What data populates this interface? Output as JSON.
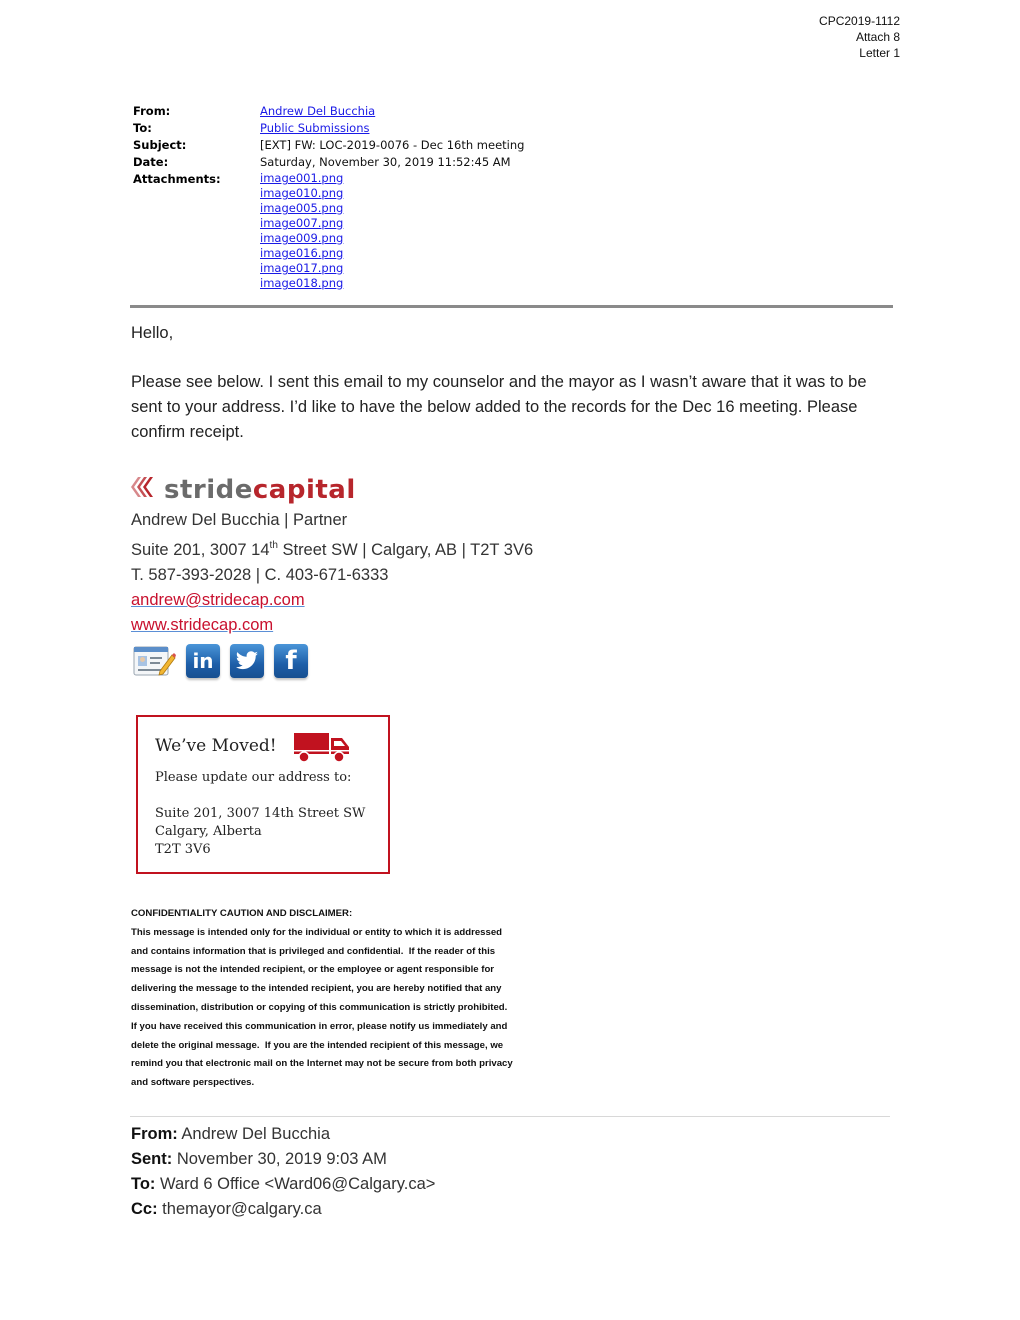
{
  "page_ref": {
    "lines": [
      "CPC2019-1112",
      "Attach 8",
      "Letter 1"
    ]
  },
  "email_header": {
    "from_label": "From:",
    "from_value": "Andrew Del Bucchia",
    "to_label": "To:",
    "to_value": "Public Submissions",
    "subject_label": "Subject:",
    "subject_value": "[EXT] FW: LOC-2019-0076 - Dec 16th meeting",
    "date_label": "Date:",
    "date_value": "Saturday, November 30, 2019 11:52:45 AM",
    "attachments_label": "Attachments:",
    "attachments": [
      "image001.png",
      "image010.png",
      "image005.png",
      "image007.png",
      "image009.png",
      "image016.png",
      "image017.png",
      "image018.png"
    ]
  },
  "body": {
    "greeting": "Hello,",
    "paragraph": "Please see below. I sent this email to my counselor and the mayor as I wasn’t aware that it was to be sent to your address. I’d like to have the below added to the records for the Dec 16 meeting. Please confirm receipt."
  },
  "signature": {
    "logo": {
      "chevrons": "«‹",
      "word1": "stride",
      "word2": "capital",
      "colors": {
        "grey": "#6b6b6b",
        "red": "#b7262c"
      }
    },
    "name_title": "Andrew Del Bucchia | Partner",
    "address_pre": "Suite 201, 3007 14",
    "address_sup": "th",
    "address_post": " Street SW | Calgary, AB | T2T 3V6",
    "phones": "T. 587-393-2028 | C. 403-671-6333",
    "email": "andrew@stridecap.com",
    "website": "www.stridecap.com",
    "social_icons": [
      {
        "name": "vcard-icon",
        "glyph": ""
      },
      {
        "name": "linkedin-icon",
        "glyph": "in"
      },
      {
        "name": "twitter-icon",
        "glyph": ""
      },
      {
        "name": "facebook-icon",
        "glyph": "f"
      }
    ]
  },
  "moved_notice": {
    "title": "We’ve Moved!",
    "subtitle": "Please update our address to:",
    "address_lines": [
      "Suite 201, 3007 14th Street SW",
      "Calgary, Alberta",
      "T2T 3V6"
    ],
    "accent_color": "#c1121f"
  },
  "disclaimer": {
    "heading": "CONFIDENTIALITY CAUTION AND DISCLAIMER:",
    "lines": [
      "This message is intended only for the individual or entity to which it is addressed",
      "and contains information that is privileged and confidential.  If the reader of this",
      "message is not the intended recipient, or the employee or agent responsible for",
      "delivering the message to the intended recipient, you are hereby notified that any",
      "dissemination, distribution or copying of this communication is strictly prohibited.",
      "If you have received this communication in error, please notify us immediately and",
      "delete the original message.  If you are the intended recipient of this message, we",
      "remind you that electronic mail on the Internet may not be secure from both privacy",
      "and software perspectives."
    ]
  },
  "forwarded": {
    "from_label": "From:",
    "from_value": " Andrew Del Bucchia",
    "sent_label": "Sent:",
    "sent_value": " November 30, 2019 9:03 AM",
    "to_label": "To:",
    "to_value": " Ward 6 Office <Ward06@Calgary.ca>",
    "cc_label": "Cc:",
    "cc_value": " themayor@calgary.ca"
  }
}
